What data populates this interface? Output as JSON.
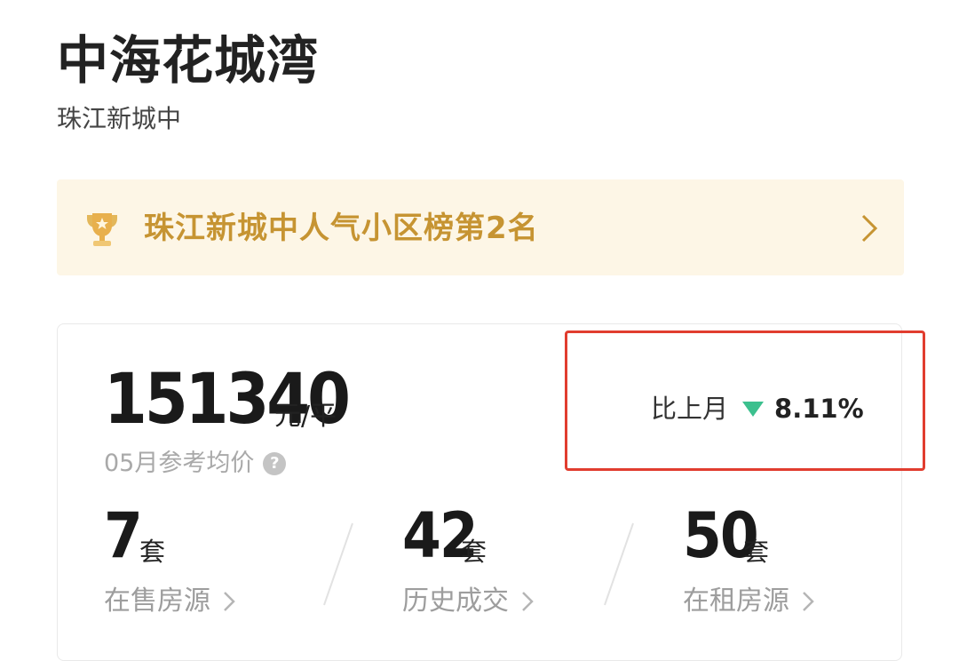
{
  "header": {
    "title": "中海花城湾",
    "subtitle": "珠江新城中"
  },
  "rank_banner": {
    "icon": "trophy-icon",
    "text": "珠江新城中人气小区榜第2名",
    "text_color": "#c69432",
    "background": "#fdf6e6"
  },
  "price": {
    "value": "151340",
    "unit": "元/平",
    "caption": "05月参考均价",
    "help_icon": "question-icon"
  },
  "month_over_month": {
    "label": "比上月",
    "direction": "down",
    "value": "8.11%",
    "arrow_color": "#3cc08e",
    "highlight_color": "#e13d2f"
  },
  "stats": [
    {
      "value": "7",
      "unit": "套",
      "label": "在售房源"
    },
    {
      "value": "42",
      "unit": "套",
      "label": "历史成交"
    },
    {
      "value": "50",
      "unit": "套",
      "label": "在租房源"
    }
  ]
}
